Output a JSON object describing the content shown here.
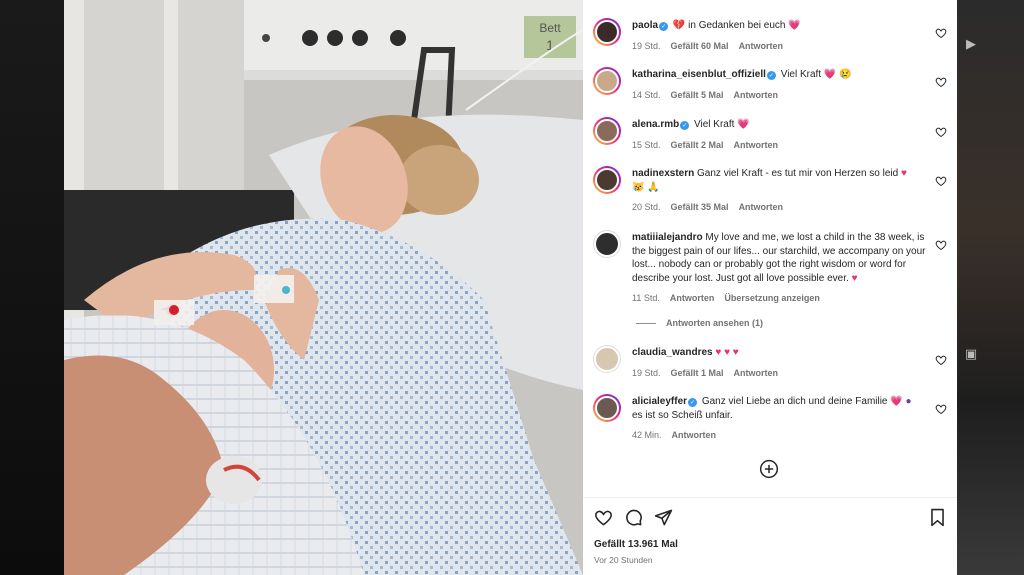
{
  "post": {
    "likes": "Gefällt 13.961 Mal",
    "time": "Vor 20 Stunden"
  },
  "photo_text": {
    "bed_label": "Bett",
    "bed_number": "1"
  },
  "comments": [
    {
      "user": "paola",
      "verified": true,
      "text": "in Gedanken bei euch",
      "time": "19 Std.",
      "likes": "Gefällt 60 Mal",
      "reply": "Antworten",
      "avatar_color": "#3b2a2a"
    },
    {
      "user": "katharina_eisenblut_offiziell",
      "verified": true,
      "text": "Viel Kraft",
      "time": "14 Std.",
      "likes": "Gefällt 5 Mal",
      "reply": "Antworten",
      "avatar_color": "#c9a98a"
    },
    {
      "user": "alena.rmb",
      "verified": true,
      "text": "Viel Kraft",
      "time": "15 Std.",
      "likes": "Gefällt 2 Mal",
      "reply": "Antworten",
      "avatar_color": "#8a6a5a"
    },
    {
      "user": "nadinexstern",
      "verified": false,
      "text": "Ganz viel Kraft - es tut mir von Herzen so leid",
      "time": "20 Std.",
      "likes": "Gefällt 35 Mal",
      "reply": "Antworten",
      "avatar_color": "#4a3a30"
    },
    {
      "user": "matiiialejandro",
      "verified": false,
      "text": "My love and me, we lost a child in the 38 week, is the biggest pain of our lifes... our starchild, we accompany on your lost... nobody can or probably got the right wisdom or word for describe your lost. Just got all love possible ever.",
      "time": "11 Std.",
      "reply": "Antworten",
      "translate": "Übersetzung anzeigen",
      "avatar_color": "#2e2e2e"
    },
    {
      "user": "claudia_wandres",
      "verified": false,
      "text": "",
      "time": "19 Std.",
      "likes": "Gefällt 1 Mal",
      "reply": "Antworten",
      "avatar_color": "#d8c7b0"
    },
    {
      "user": "alicialeyffer",
      "verified": true,
      "text": "Ganz viel Liebe an dich und deine Familie",
      "text2": "es ist so Scheiß unfair.",
      "time": "42 Min.",
      "reply": "Antworten",
      "avatar_color": "#6a5a52"
    }
  ],
  "replies_toggle": "Antworten ansehen (1)",
  "colors": {
    "accent_heart": "#e8336b",
    "verified": "#3897f0",
    "muted_text": "#737373"
  },
  "icons": [
    "heart-icon",
    "comment-icon",
    "share-icon",
    "bookmark-icon",
    "add-comment-icon",
    "chevron-right-icon"
  ]
}
